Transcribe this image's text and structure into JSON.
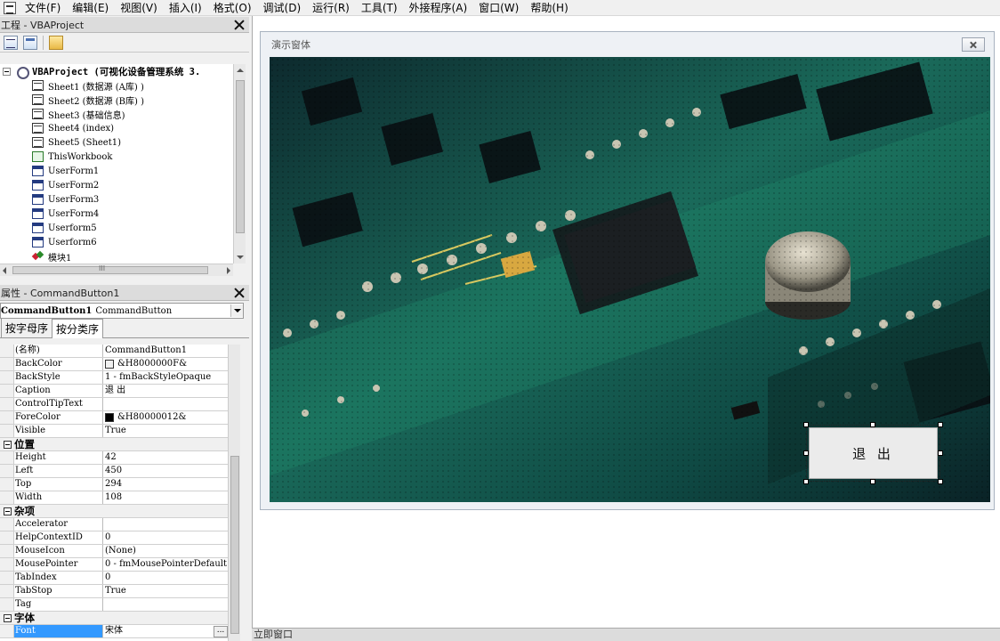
{
  "menu": [
    "文件(F)",
    "编辑(E)",
    "视图(V)",
    "插入(I)",
    "格式(O)",
    "调试(D)",
    "运行(R)",
    "工具(T)",
    "外接程序(A)",
    "窗口(W)",
    "帮助(H)"
  ],
  "project_pane": {
    "title": "工程 - VBAProject",
    "root": "VBAProject (可视化设备管理系统 3.",
    "items": [
      {
        "label": "Sheet1 (数据源 (A库) )",
        "icon": "sheet-icon"
      },
      {
        "label": "Sheet2 (数据源 (B库) )",
        "icon": "sheet-icon"
      },
      {
        "label": "Sheet3 (基础信息)",
        "icon": "sheet-icon"
      },
      {
        "label": "Sheet4 (index)",
        "icon": "sheet-icon"
      },
      {
        "label": "Sheet5 (Sheet1)",
        "icon": "sheet-icon"
      },
      {
        "label": "ThisWorkbook",
        "icon": "workbook-icon"
      },
      {
        "label": "UserForm1",
        "icon": "userform-icon"
      },
      {
        "label": "UserForm2",
        "icon": "userform-icon"
      },
      {
        "label": "UserForm3",
        "icon": "userform-icon"
      },
      {
        "label": "UserForm4",
        "icon": "userform-icon"
      },
      {
        "label": "Userform5",
        "icon": "userform-icon"
      },
      {
        "label": "Userform6",
        "icon": "userform-icon"
      },
      {
        "label": "模块1",
        "icon": "module-icon"
      }
    ],
    "hscroll_label": "III"
  },
  "properties_pane": {
    "title": "属性 - CommandButton1",
    "object_name": "CommandButton1",
    "object_type": "CommandButton",
    "tabs": [
      "按字母序",
      "按分类序"
    ],
    "active_tab": 1,
    "rows": [
      {
        "k": "(名称)",
        "v": "CommandButton1"
      },
      {
        "k": "BackColor",
        "v": "&H8000000F&",
        "swatch": "#f0f0f0"
      },
      {
        "k": "BackStyle",
        "v": "1 - fmBackStyleOpaque"
      },
      {
        "k": "Caption",
        "v": "退 出"
      },
      {
        "k": "ControlTipText",
        "v": ""
      },
      {
        "k": "ForeColor",
        "v": "&H80000012&",
        "swatch": "#000000"
      },
      {
        "k": "Visible",
        "v": "True"
      },
      {
        "cat": "位置"
      },
      {
        "k": "Height",
        "v": "42"
      },
      {
        "k": "Left",
        "v": "450"
      },
      {
        "k": "Top",
        "v": "294"
      },
      {
        "k": "Width",
        "v": "108"
      },
      {
        "cat": "杂项"
      },
      {
        "k": "Accelerator",
        "v": ""
      },
      {
        "k": "HelpContextID",
        "v": "0"
      },
      {
        "k": "MouseIcon",
        "v": "(None)"
      },
      {
        "k": "MousePointer",
        "v": "0 - fmMousePointerDefault"
      },
      {
        "k": "TabIndex",
        "v": "0"
      },
      {
        "k": "TabStop",
        "v": "True"
      },
      {
        "k": "Tag",
        "v": ""
      },
      {
        "cat": "字体"
      },
      {
        "k": "Font",
        "v": "宋体",
        "selected": true,
        "ellipsis": "..."
      }
    ]
  },
  "designer": {
    "form_caption": "演示窗体",
    "exit_button": "退 出"
  },
  "immediate_title": "立即窗口"
}
